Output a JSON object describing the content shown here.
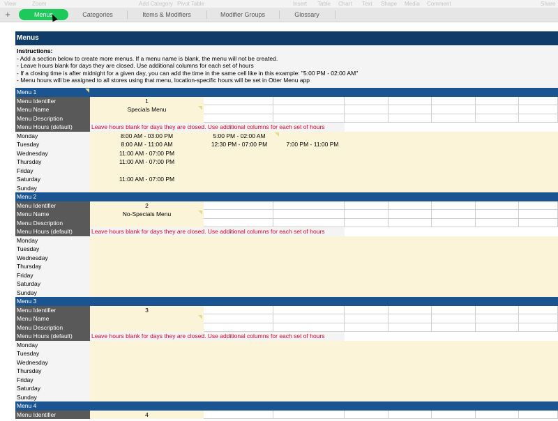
{
  "toolbar": {
    "items": [
      "View",
      "Zoom",
      "Add Category",
      "Pivot Table",
      "Insert",
      "Table",
      "Chart",
      "Text",
      "Shape",
      "Media",
      "Comment",
      "Share"
    ]
  },
  "tabs": [
    {
      "label": "Menus",
      "active": true
    },
    {
      "label": "Categories",
      "active": false
    },
    {
      "label": "Items & Modifiers",
      "active": false
    },
    {
      "label": "Modifier Groups",
      "active": false
    },
    {
      "label": "Glossary",
      "active": false
    }
  ],
  "add_sheet_label": "+",
  "sheet": {
    "title": "Menus",
    "instructions_head": "Instructions:",
    "instructions": [
      "- Add a section below to create more menus. If a menu name is blank, the menu will not be created.",
      "- Leave hours blank for days they are closed. Use additional columns for each set of hours",
      "- If a closing time is after midnight for a given day, you can add the time in the same cell like in this example: \"5:00 PM - 02:00 AM\"",
      "- Menu hours will be assigned to all stores using that menu, location-specific hours will be set in Otter Menu app"
    ]
  },
  "labels": {
    "identifier": "Menu Identifier",
    "name": "Menu Name",
    "description": "Menu Description",
    "hours": "Menu Hours (default)",
    "hours_warning": "Leave hours blank for days they are closed. Use additional columns for each set of hours"
  },
  "days": [
    "Monday",
    "Tuesday",
    "Wednesday",
    "Thursday",
    "Friday",
    "Saturday",
    "Sunday"
  ],
  "menus": [
    {
      "header": "Menu 1",
      "identifier": "1",
      "name": "Specials Menu",
      "description": "",
      "hours": [
        [
          "8:00 AM - 03:00 PM",
          "5:00 PM - 02:00 AM",
          ""
        ],
        [
          "8:00 AM - 11:00 AM",
          "12:30 PM - 07:00 PM",
          "7:00 PM - 11:00 PM"
        ],
        [
          "11:00 AM - 07:00 PM",
          "",
          ""
        ],
        [
          "11:00 AM - 07:00 PM",
          "",
          ""
        ],
        [
          "",
          "",
          ""
        ],
        [
          "11:00 AM - 07:00 PM",
          "",
          ""
        ],
        [
          "",
          "",
          ""
        ]
      ]
    },
    {
      "header": "Menu 2",
      "identifier": "2",
      "name": "No-Specials Menu",
      "description": "",
      "hours": [
        [
          "",
          "",
          ""
        ],
        [
          "",
          "",
          ""
        ],
        [
          "",
          "",
          ""
        ],
        [
          "",
          "",
          ""
        ],
        [
          "",
          "",
          ""
        ],
        [
          "",
          "",
          ""
        ],
        [
          "",
          "",
          ""
        ]
      ]
    },
    {
      "header": "Menu 3",
      "identifier": "3",
      "name": "",
      "description": "",
      "hours": [
        [
          "",
          "",
          ""
        ],
        [
          "",
          "",
          ""
        ],
        [
          "",
          "",
          ""
        ],
        [
          "",
          "",
          ""
        ],
        [
          "",
          "",
          ""
        ],
        [
          "",
          "",
          ""
        ],
        [
          "",
          "",
          ""
        ]
      ]
    },
    {
      "header": "Menu 4",
      "identifier": "4",
      "name": "",
      "description": "",
      "hours": []
    }
  ]
}
